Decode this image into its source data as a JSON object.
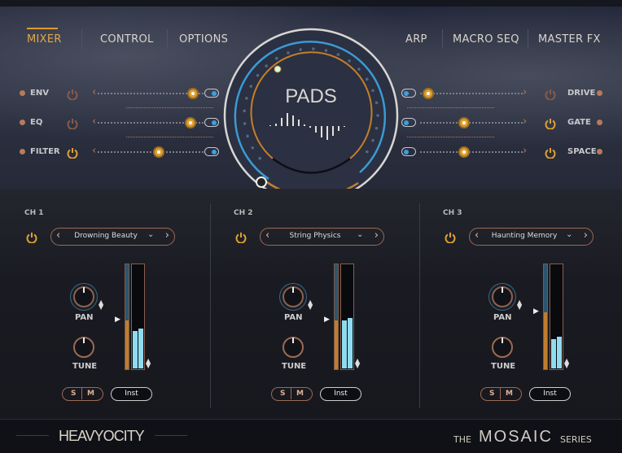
{
  "nav": {
    "left": [
      {
        "label": "MIXER",
        "active": true
      },
      {
        "label": "CONTROL"
      },
      {
        "label": "OPTIONS"
      }
    ],
    "right": [
      {
        "label": "ARP"
      },
      {
        "label": "MACRO SEQ"
      },
      {
        "label": "MASTER FX"
      }
    ]
  },
  "fx_left": [
    {
      "label": "ENV",
      "power": false,
      "value": 0.9
    },
    {
      "label": "EQ",
      "power": false,
      "value": 0.88
    },
    {
      "label": "FILTER",
      "power": true,
      "value": 0.58
    }
  ],
  "fx_right": [
    {
      "label": "DRIVE",
      "power": false,
      "value": 0.05
    },
    {
      "label": "GATE",
      "power": true,
      "value": 0.42
    },
    {
      "label": "SPACE",
      "power": true,
      "value": 0.42
    }
  ],
  "center": {
    "title": "PADS"
  },
  "channels": [
    {
      "label": "CH 1",
      "preset": "Drowning Beauty",
      "pan": "PAN",
      "tune": "TUNE",
      "solo": "S",
      "mute": "M",
      "output": "Inst",
      "volume": 0.47,
      "level": 0.4
    },
    {
      "label": "CH 2",
      "preset": "String Physics",
      "pan": "PAN",
      "tune": "TUNE",
      "solo": "S",
      "mute": "M",
      "output": "Inst",
      "volume": 0.47,
      "level": 0.5
    },
    {
      "label": "CH 3",
      "preset": "Haunting Memory",
      "pan": "PAN",
      "tune": "TUNE",
      "solo": "S",
      "mute": "M",
      "output": "Inst",
      "volume": 0.55,
      "level": 0.32
    }
  ],
  "footer": {
    "brand": "HEAVYOCITY",
    "series_the": "THE",
    "series_name": "MOSAIC",
    "series_word": "SERIES"
  },
  "colors": {
    "accent": "#e09a2e",
    "blue": "#3aa0e0",
    "meter": "#8fdcf0"
  }
}
